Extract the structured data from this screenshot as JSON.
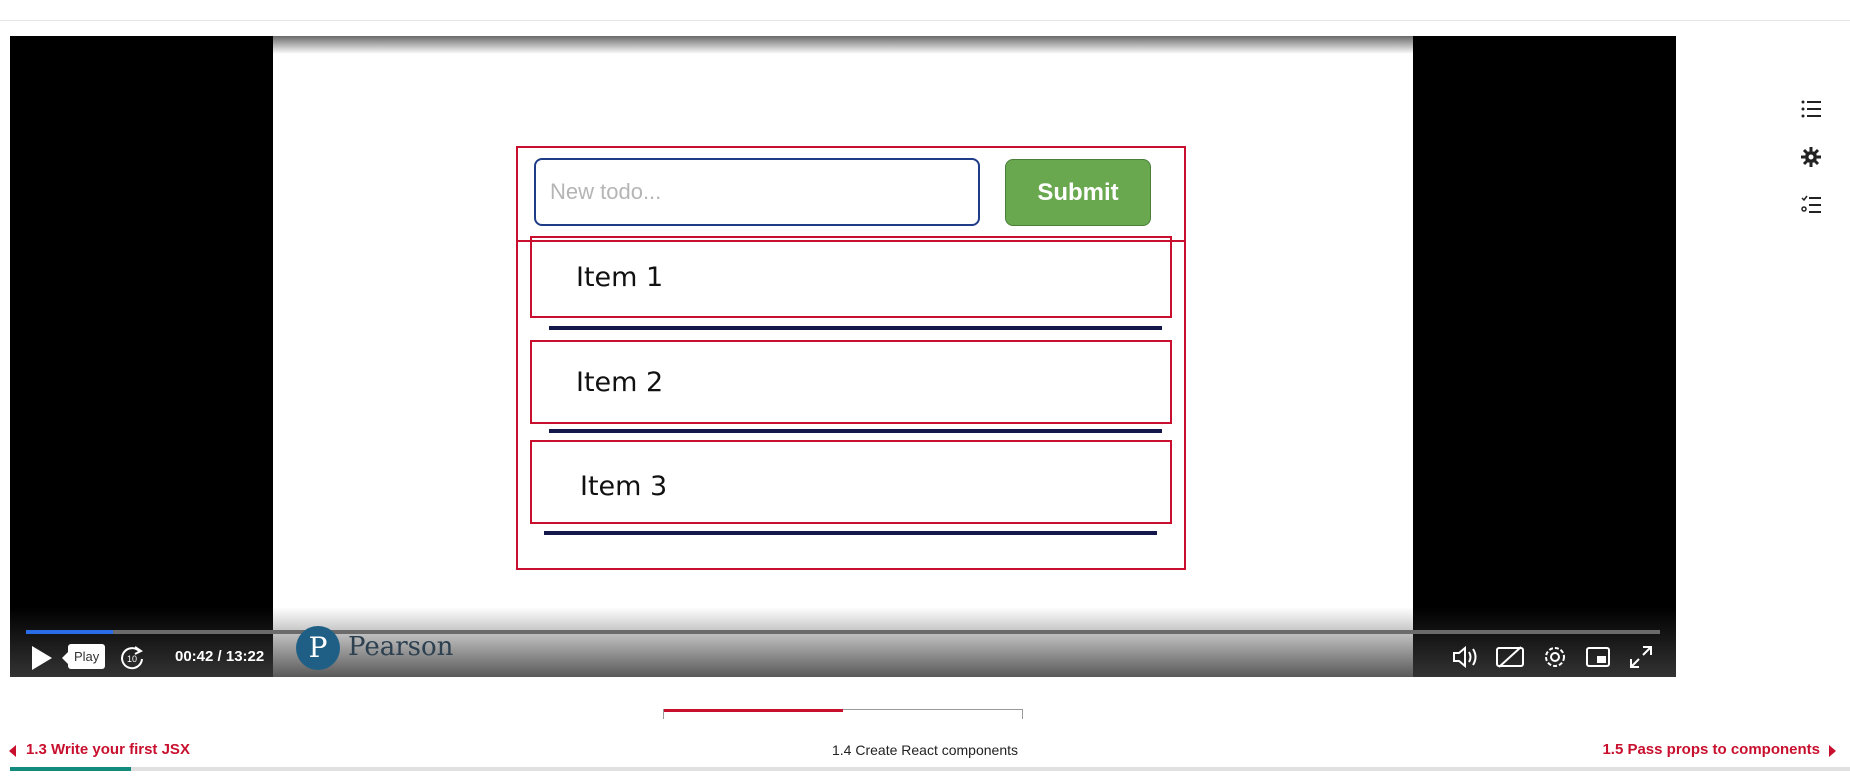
{
  "slide": {
    "input_placeholder": "New todo...",
    "submit_label": "Submit",
    "items": [
      "Item 1",
      "Item 2",
      "Item 3"
    ],
    "brand": "Pearson",
    "brand_mark": "P"
  },
  "player": {
    "play_tooltip": "Play",
    "time": "00:42 / 13:22",
    "progress_fraction": 0.053,
    "skip_label": "10",
    "progress_color": "#2a6ce8"
  },
  "nav": {
    "prev_label": "1.3 Write your first JSX",
    "current_label": "1.4 Create React components",
    "next_label": "1.5 Pass props to components",
    "course_progress_fraction": 0.066,
    "accent": "#c8102e"
  },
  "sidebar": {
    "icons": [
      "list-icon",
      "gear-icon",
      "checklist-icon"
    ]
  }
}
